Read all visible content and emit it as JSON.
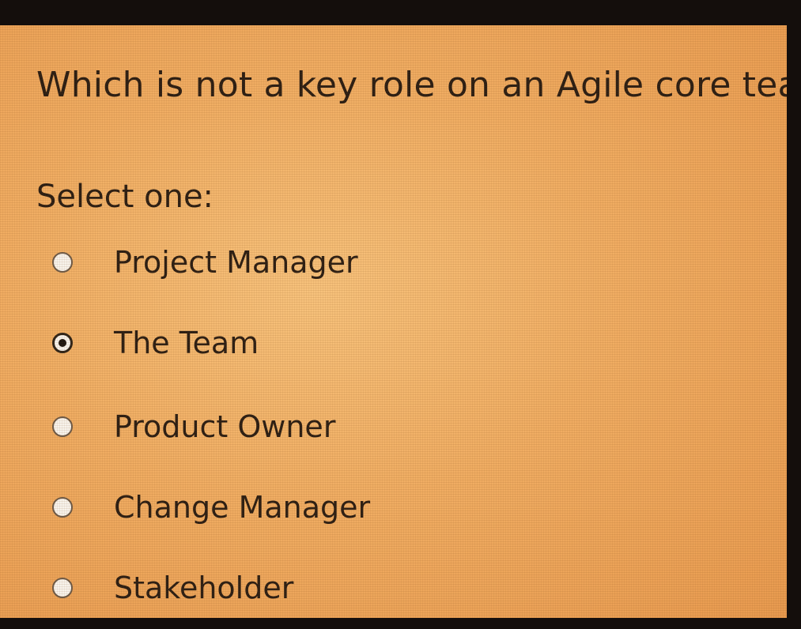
{
  "question": {
    "text": "Which is not a key role on an Agile core team?",
    "prompt": "Select one:"
  },
  "options": [
    {
      "label": "Project Manager",
      "selected": false
    },
    {
      "label": "The Team",
      "selected": true
    },
    {
      "label": "Product Owner",
      "selected": false
    },
    {
      "label": "Change Manager",
      "selected": false
    },
    {
      "label": "Stakeholder",
      "selected": false
    }
  ],
  "colors": {
    "background": "#f0ad63",
    "text": "#2b1e14",
    "radio_fill": "#f8f3ec"
  }
}
